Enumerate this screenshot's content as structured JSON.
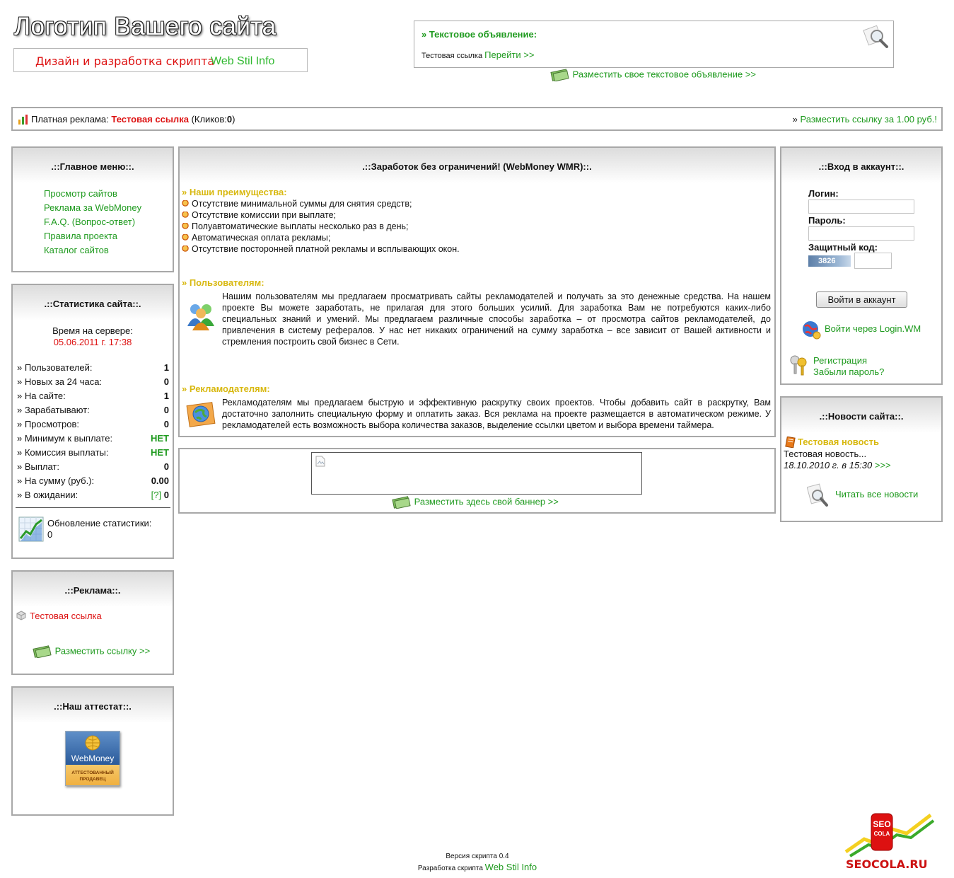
{
  "header": {
    "logo_text": "Логотип Вашего сайта",
    "slogan_red": "Дизайн и разработка скрипта",
    "slogan_green": "Web Stil Info",
    "text_ad": {
      "title": "» Текстовое объявление:",
      "body": "Тестовая ссылка",
      "link": "Перейти >>"
    },
    "place_text_ad": "Разместить свое текстовое объявление >>"
  },
  "paid_ad_bar": {
    "label": "Платная реклама:",
    "link": "Тестовая ссылка",
    "clicks_prefix": "(Кликов:",
    "clicks": "0",
    "clicks_suffix": ")",
    "right_prefix": "»",
    "right_link": "Разместить ссылку за 1.00 руб.!"
  },
  "main_menu": {
    "title": ".::Главное меню::.",
    "items": [
      "Просмотр сайтов",
      "Реклама за WebMoney",
      "F.A.Q. (Вопрос-ответ)",
      "Правила проекта",
      "Каталог сайтов"
    ]
  },
  "stats": {
    "title": ".::Статистика сайта::.",
    "server_time_label": "Время на сервере:",
    "server_time": "05.06.2011 г. 17:38",
    "rows": [
      {
        "label": "» Пользователей:",
        "value": "1"
      },
      {
        "label": "» Новых за 24 часа:",
        "value": "0"
      },
      {
        "label": "» На сайте:",
        "value": "1"
      },
      {
        "label": "» Зарабатывают:",
        "value": "0"
      },
      {
        "label": "» Просмотров:",
        "value": "0"
      },
      {
        "label": "» Минимум к выплате:",
        "value": "НЕТ"
      },
      {
        "label": "» Комиссия выплаты:",
        "value": "НЕТ"
      },
      {
        "label": "» Выплат:",
        "value": "0"
      },
      {
        "label": "» На сумму (руб.):",
        "value": "0.00"
      },
      {
        "label": "» В ожидании:",
        "value": "0",
        "hint": "[?]"
      }
    ],
    "update_label": "Обновление статистики:",
    "update_value": "0"
  },
  "ads_panel": {
    "title": ".::Реклама::.",
    "link": "Тестовая ссылка",
    "place_link": "Разместить ссылку >>"
  },
  "attestat": {
    "title": ".::Наш аттестат::.",
    "badge_brand": "WebMoney",
    "badge_line1": "АТТЕСТОВАННЫЙ",
    "badge_line2": "ПРОДАВЕЦ"
  },
  "center": {
    "title": ".::Заработок без ограничений! (WebMoney WMR)::.",
    "advantages_title": "» Наши преимущества:",
    "advantages": [
      "Отсутствие минимальной суммы для снятия средств;",
      "Отсутствие комиссии при выплате;",
      "Полуавтоматические выплаты несколько раз в день;",
      "Автоматическая оплата рекламы;",
      "Отсутствие посторонней платной рекламы и всплывающих окон."
    ],
    "users_title": "» Пользователям:",
    "users_text": "Нашим пользователям мы предлагаем просматривать сайты рекламодателей и получать за это денежные средства. На нашем проекте Вы можете заработать, не прилагая для этого больших усилий. Для заработка Вам не потребуются каких-либо специальных знаний и умений. Мы предлагаем различные способы заработка – от просмотра сайтов рекламодателей, до привлечения в систему рефералов. У нас нет никаких ограничений на сумму заработка – все зависит от Вашей активности и стремления построить свой бизнес в Сети.",
    "advertisers_title": "» Рекламодателям:",
    "advertisers_text": "Рекламодателям мы предлагаем быструю и эффективную раскрутку своих проектов. Чтобы добавить сайт в раскрутку, Вам достаточно заполнить специальную форму и оплатить заказ. Вся реклама на проекте размещается в автоматическом режиме. У рекламодателей есть возможность выбора количества заказов, выделение ссылки цветом и выбора времени таймера.",
    "banner_place_link": "Разместить здесь свой баннер >>"
  },
  "login": {
    "title": ".::Вход в аккаунт::.",
    "login_label": "Логин:",
    "password_label": "Пароль:",
    "captcha_label": "Защитный код:",
    "captcha_code": "3826",
    "submit": "Войти в аккаунт",
    "login_wm": "Войти через Login.WM",
    "register": "Регистрация",
    "forgot": "Забыли пароль?"
  },
  "news": {
    "title": ".::Новости сайта::.",
    "item_title": "Тестовая новость",
    "item_text": "Тестовая новость...",
    "item_date": "18.10.2010 г. в 15:30",
    "item_more": ">>>",
    "all_news": "Читать все новости"
  },
  "footer": {
    "version": "Версия скрипта 0.4",
    "dev_label": "Разработка скрипта",
    "dev_link": "Web Stil Info",
    "seocola_top": "SEO",
    "seocola_mid": "COLA",
    "seocola_domain": "SEOCOLA.RU"
  }
}
